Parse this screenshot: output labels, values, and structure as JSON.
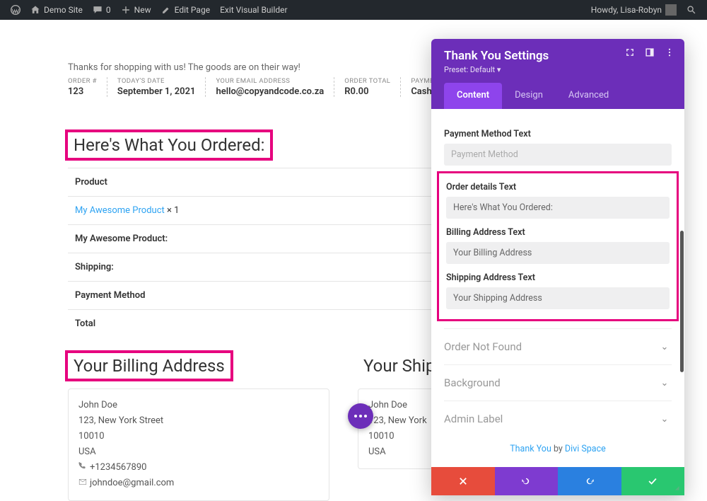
{
  "adminbar": {
    "site": "Demo Site",
    "comments": "0",
    "new": "New",
    "edit_page": "Edit Page",
    "exit_vb": "Exit Visual Builder",
    "howdy": "Howdy, Lisa-Robyn"
  },
  "page": {
    "thanks": "Thanks for shopping with us! The goods are on their way!",
    "meta": {
      "order_no_lbl": "ORDER #",
      "order_no": "123",
      "date_lbl": "TODAY'S DATE",
      "date": "September 1, 2021",
      "email_lbl": "YOUR EMAIL ADDRESS",
      "email": "hello@copyandcode.co.za",
      "total_lbl": "ORDER TOTAL",
      "total": "R0.00",
      "pay_lbl": "PAYMENT",
      "pay": "Cash o"
    },
    "ordered_title": "Here's What You Ordered:",
    "table": {
      "product_hdr": "Product",
      "product_link": "My Awesome Product",
      "qty": " × 1",
      "row2": "My Awesome Product:",
      "row3": "Shipping:",
      "row4": "Payment Method",
      "row5": "Total"
    },
    "billing_title": "Your Billing Address",
    "shipping_title": "Your Ship",
    "addr": {
      "name": "John Doe",
      "street": "123, New York Street",
      "zip": "10010",
      "country": "USA",
      "phone": "+1234567890",
      "email": "johndoe@gmail.com",
      "name2": "John Doe",
      "street2": "123, New York",
      "zip2": "10010",
      "country2": "USA"
    }
  },
  "panel": {
    "title": "Thank You Settings",
    "preset": "Preset: Default",
    "tabs": {
      "content": "Content",
      "design": "Design",
      "advanced": "Advanced"
    },
    "fields": {
      "pay_lbl": "Payment Method Text",
      "pay_val": "Payment Method",
      "od_lbl": "Order details Text",
      "od_val": "Here's What You Ordered:",
      "ba_lbl": "Billing Address Text",
      "ba_val": "Your Billing Address",
      "sa_lbl": "Shipping Address Text",
      "sa_val": "Your Shipping Address"
    },
    "acc": {
      "nf": "Order Not Found",
      "bg": "Background",
      "al": "Admin Label"
    },
    "credit": {
      "module": "Thank You",
      "by": " by ",
      "author": "Divi Space"
    }
  }
}
